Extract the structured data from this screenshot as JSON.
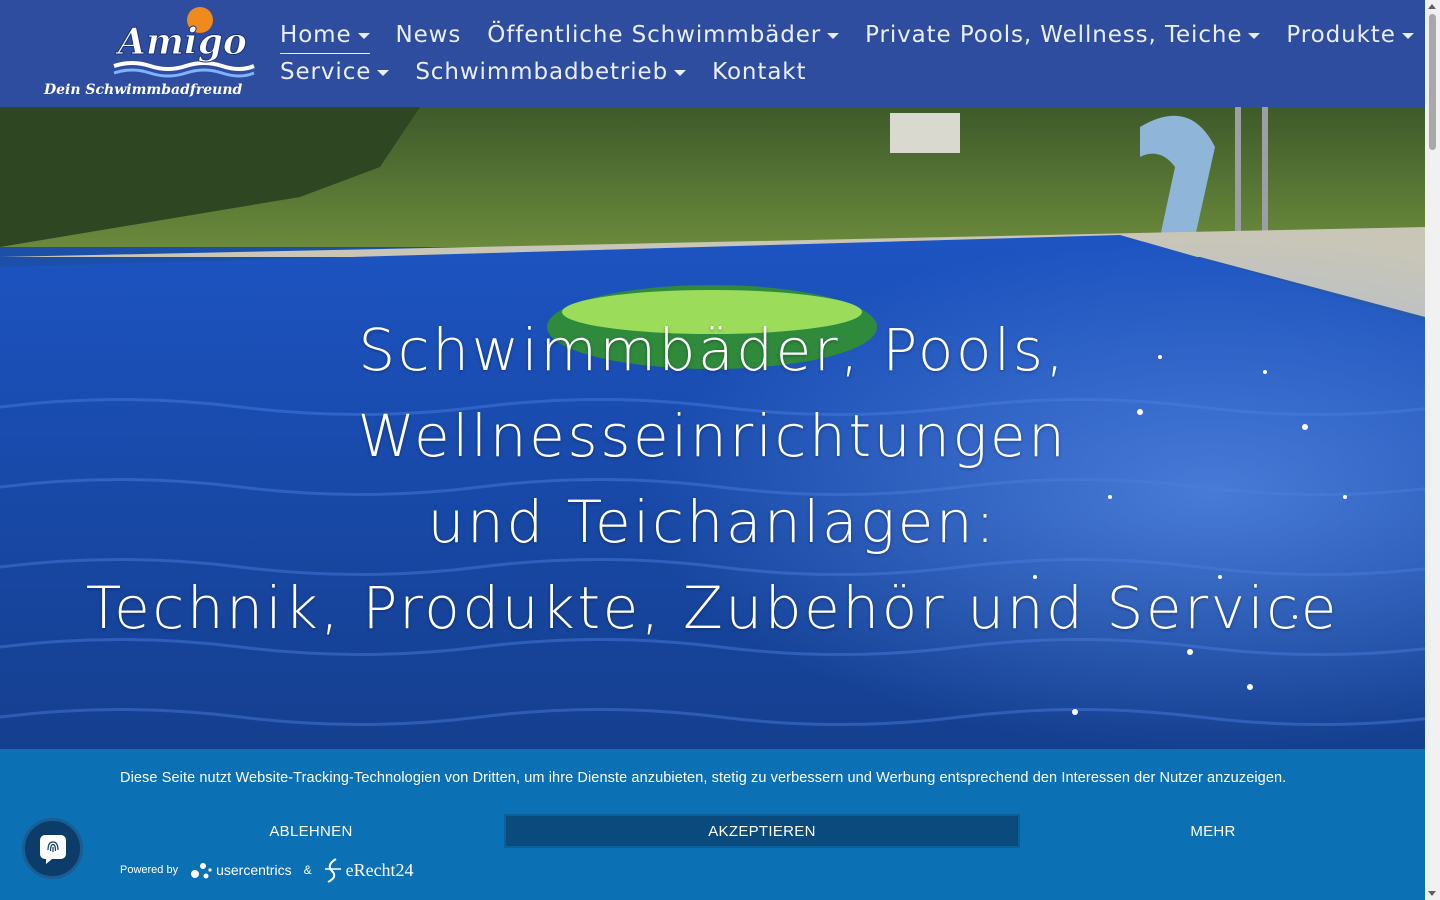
{
  "brand": {
    "logo_word": "Amigo",
    "logo_tagline": "Dein Schwimmbadfreund"
  },
  "nav": {
    "row1": [
      {
        "label": "Home",
        "dropdown": true,
        "active": true
      },
      {
        "label": "News",
        "dropdown": false,
        "active": false
      },
      {
        "label": "Öffentliche Schwimmbäder",
        "dropdown": true,
        "active": false
      },
      {
        "label": "Private Pools, Wellness, Teiche",
        "dropdown": true,
        "active": false
      },
      {
        "label": "Produkte",
        "dropdown": true,
        "active": false
      }
    ],
    "row2": [
      {
        "label": "Service",
        "dropdown": true,
        "active": false
      },
      {
        "label": "Schwimmbadbetrieb",
        "dropdown": true,
        "active": false
      },
      {
        "label": "Kontakt",
        "dropdown": false,
        "active": false
      }
    ]
  },
  "hero": {
    "line1": "Schwimmbäder, Pools, Wellnesseinrichtungen",
    "line2": "und Teichanlagen:",
    "line3": "Technik, Produkte, Zubehör und Service"
  },
  "cookie": {
    "text": "Diese Seite nutzt Website-Tracking-Technologien von Dritten, um ihre Dienste anzubieten, stetig zu verbessern und Werbung entsprechend den Interessen der Nutzer anzuzeigen.",
    "deny_label": "ABLEHNEN",
    "accept_label": "AKZEPTIEREN",
    "more_label": "MEHR",
    "powered_by": "Powered by",
    "usercentrics": "usercentrics",
    "amp": "&",
    "erecht": "eRecht24"
  },
  "colors": {
    "header_bg": "#2f4d9f",
    "banner_bg": "#0c70b4",
    "accept_bg": "#0b4a7d",
    "logo_orange": "#f08a1c"
  }
}
